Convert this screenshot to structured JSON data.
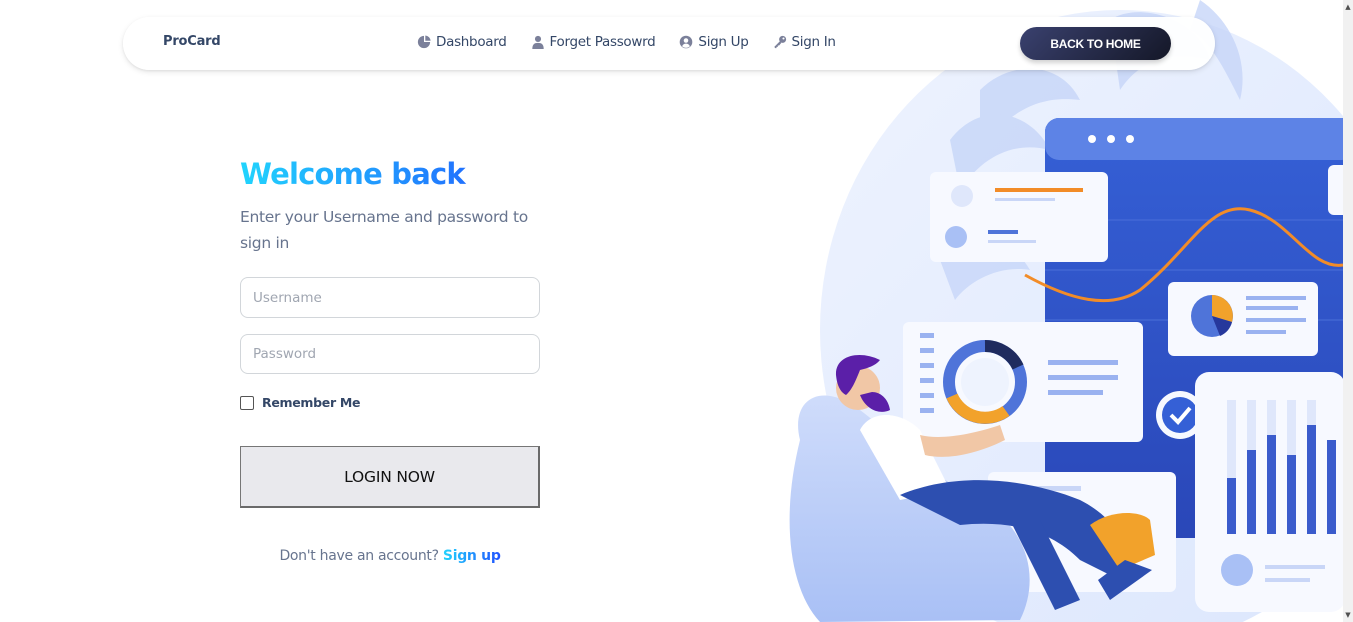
{
  "navbar": {
    "brand": "ProCard",
    "links": [
      {
        "label": "Dashboard",
        "icon": "pie-chart-icon"
      },
      {
        "label": "Forget Passowrd",
        "icon": "user-icon"
      },
      {
        "label": "Sign Up",
        "icon": "user-circle-icon"
      },
      {
        "label": "Sign In",
        "icon": "key-icon"
      }
    ],
    "back_button": "BACK TO HOME"
  },
  "form": {
    "title": "Welcome back",
    "subtitle": "Enter your Username and password to sign in",
    "username_placeholder": "Username",
    "password_placeholder": "Password",
    "remember_label": "Remember Me",
    "login_button": "LOGIN NOW",
    "signup_prompt": "Don't have an account?",
    "signup_link": "Sign up"
  },
  "colors": {
    "accent_gradient_start": "#21d4fd",
    "accent_gradient_end": "#2152ff",
    "dark_button": "#252a45",
    "text": "#344767"
  }
}
